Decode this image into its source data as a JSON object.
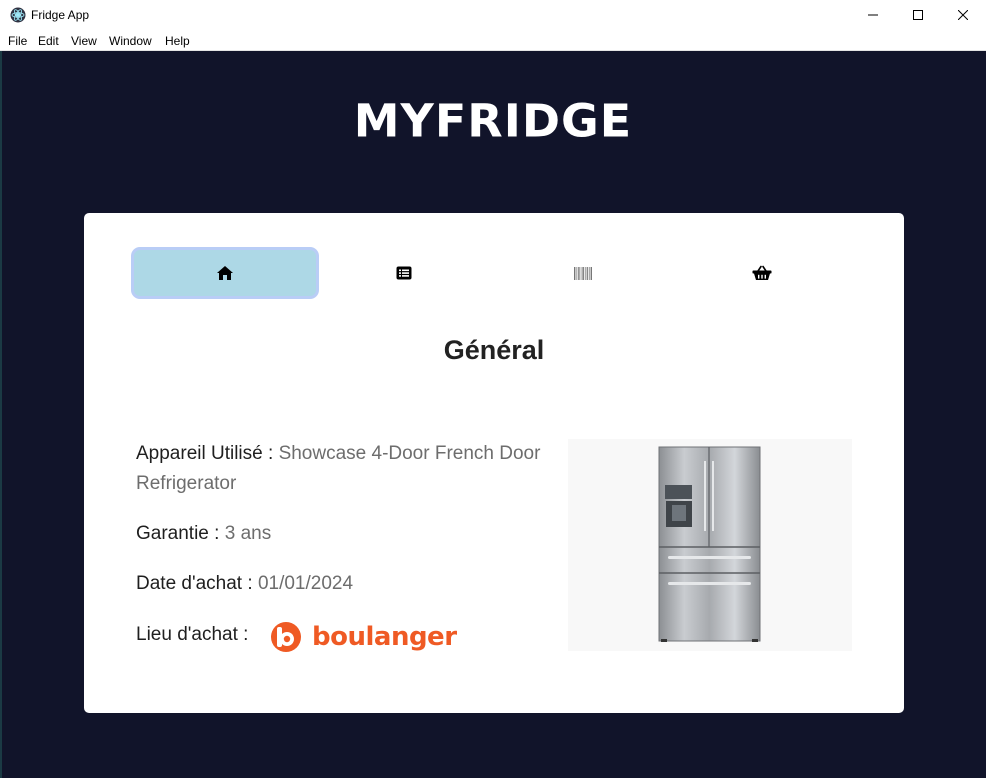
{
  "window": {
    "title": "Fridge App"
  },
  "menu": {
    "items": [
      "File",
      "Edit",
      "View",
      "Window",
      "Help"
    ]
  },
  "header": {
    "brand": "MYFRIDGE"
  },
  "tabs": [
    {
      "icon": "home-icon",
      "active": true
    },
    {
      "icon": "list-icon",
      "active": false
    },
    {
      "icon": "barcode-icon",
      "active": false
    },
    {
      "icon": "basket-icon",
      "active": false
    }
  ],
  "colors": {
    "background": "#11142a",
    "active_tab": "#add8e6",
    "brand_orange": "#ef5a24"
  },
  "main": {
    "title": "Général",
    "device_label": "Appareil Utilisé : ",
    "device_value": "Showcase 4-Door French Door Refrigerator",
    "warranty_label": "Garantie : ",
    "warranty_value": "3 ans",
    "date_label": "Date d'achat : ",
    "date_value": "01/01/2024",
    "place_label": "Lieu d'achat : ",
    "shop_logo_text": "boulanger"
  }
}
